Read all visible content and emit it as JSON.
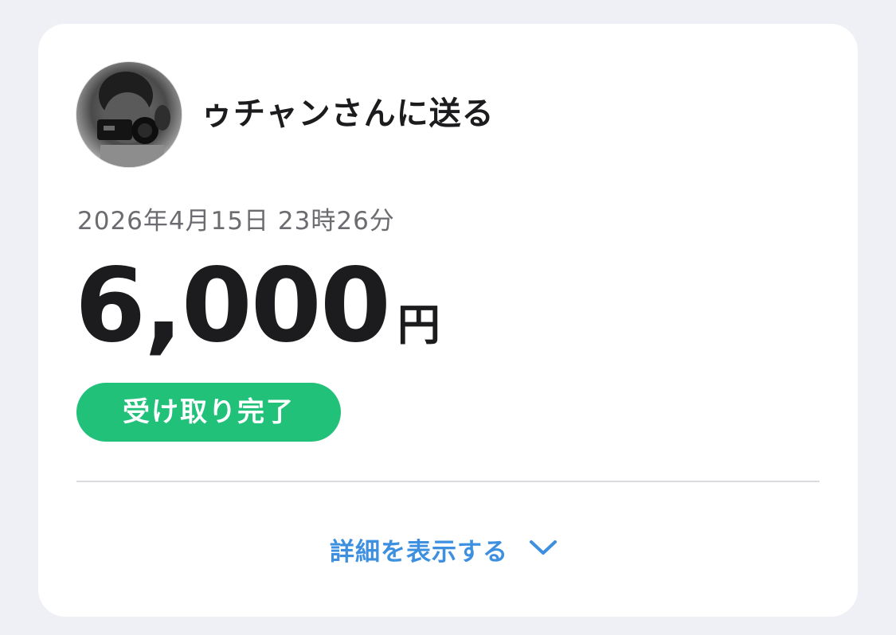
{
  "transfer": {
    "recipient_title": "ゥチャンさんに送る",
    "datetime": "2026年4月15日 23時26分",
    "amount": "6,000",
    "currency": "円",
    "status": "受け取り完了",
    "status_color": "#22c17a"
  },
  "details": {
    "label": "詳細を表示する",
    "icon": "chevron-down-icon",
    "color": "#3d8fe0"
  },
  "avatar": {
    "icon": "avatar"
  }
}
